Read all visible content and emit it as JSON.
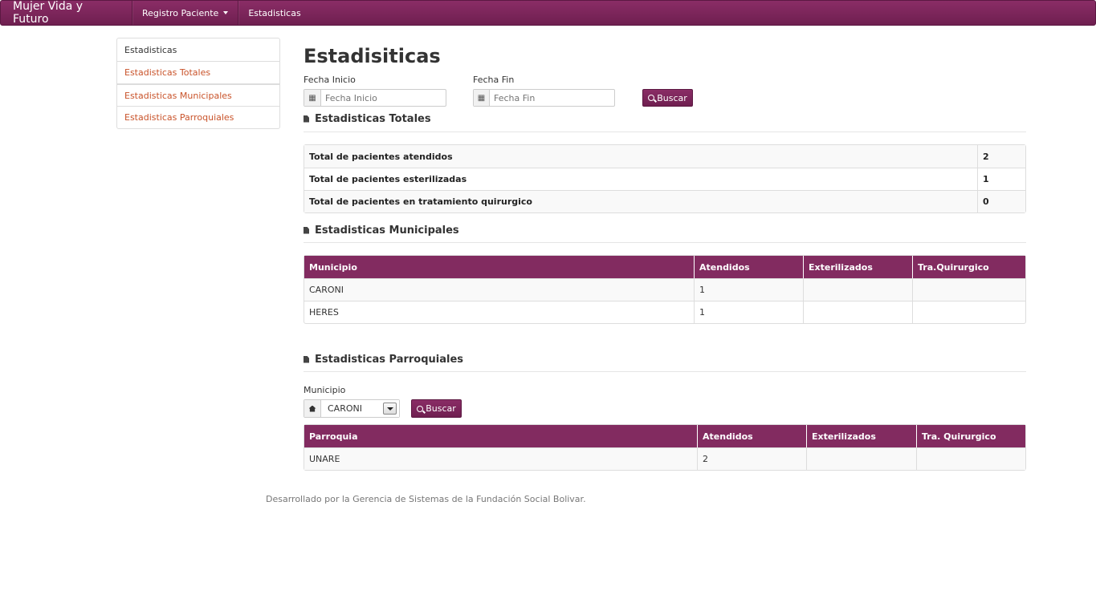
{
  "navbar": {
    "brand": "Mujer Vida y Futuro",
    "items": [
      {
        "label": "Registro Paciente",
        "dropdown": true
      },
      {
        "label": "Estadisticas",
        "dropdown": false
      }
    ]
  },
  "sidebar": {
    "items": [
      {
        "label": "Estadisticas"
      },
      {
        "label": "Estadisticas Totales"
      },
      {
        "label": "Estadisticas Municipales"
      },
      {
        "label": "Estadisticas Parroquiales"
      }
    ]
  },
  "main": {
    "title": "Estadisiticas",
    "date_filter": {
      "start_label": "Fecha Inicio",
      "start_placeholder": "Fecha Inicio",
      "end_label": "Fecha Fin",
      "end_placeholder": "Fecha Fin",
      "search_label": "Buscar"
    },
    "totals": {
      "heading": "Estadisticas Totales",
      "rows": [
        {
          "label": "Total de pacientes atendidos",
          "value": "2"
        },
        {
          "label": "Total de pacientes esterilizadas",
          "value": "1"
        },
        {
          "label": "Total de pacientes en tratamiento quirurgico",
          "value": "0"
        }
      ]
    },
    "municipal": {
      "heading": "Estadisticas Municipales",
      "columns": [
        "Municipio",
        "Atendidos",
        "Exterilizados",
        "Tra.Quirurgico"
      ],
      "rows": [
        [
          "CARONI",
          "1",
          "",
          ""
        ],
        [
          "HERES",
          "1",
          "",
          ""
        ]
      ]
    },
    "parish": {
      "heading": "Estadisticas Parroquiales",
      "municipio_label": "Municipio",
      "selected_municipio": "CARONI",
      "search_label": "Buscar",
      "columns": [
        "Parroquia",
        "Atendidos",
        "Exterilizados",
        "Tra. Quirurgico"
      ],
      "rows": [
        [
          "UNARE",
          "2",
          "",
          ""
        ]
      ]
    }
  },
  "footer": "Desarrollado por la Gerencia de Sistemas de la Fundación Social Bolivar.",
  "colors": {
    "primary": "#822b60",
    "link": "#c9532a"
  }
}
